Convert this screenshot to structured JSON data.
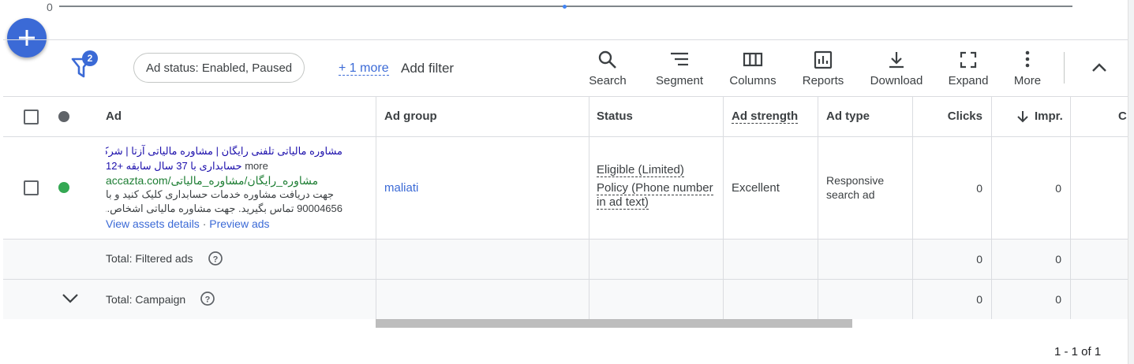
{
  "chart": {
    "zero_label": "0"
  },
  "fab": {
    "icon": "plus-icon"
  },
  "toolbar": {
    "filter_count": "2",
    "status_chip": "Ad status: Enabled, Paused",
    "more_filters": "+ 1 more",
    "add_filter": "Add filter",
    "buttons": {
      "search": "Search",
      "segment": "Segment",
      "columns": "Columns",
      "reports": "Reports",
      "download": "Download",
      "expand": "Expand",
      "more": "More"
    }
  },
  "table": {
    "headers": {
      "ad": "Ad",
      "ad_group": "Ad group",
      "status": "Status",
      "ad_strength": "Ad strength",
      "ad_type": "Ad type",
      "clicks": "Clicks",
      "impr": "Impr.",
      "ctr_partial": "C"
    },
    "row": {
      "headline_1": "مشاوره مالیاتی تلفنی رایگان | مشاوره مالیاتی آزتا | شرکت",
      "headline_2": "حسابداری با 37 سال سابقه +12",
      "headline_more": "more",
      "display_url": "accazta.com/مشاوره_رایگان/مشاوره_مالیاتی",
      "description_1": "جهت دریافت مشاوره خدمات حسابداری کلیک کنید و با",
      "description_2": "90004656 تماس بگیرید. جهت مشاوره مالیاتی اشخاص...",
      "view_assets": "View assets details",
      "separator": "·",
      "preview_ads": "Preview ads",
      "ad_group": "maliati",
      "status_1": "Eligible (Limited)",
      "status_2_a": "Policy (Phone number",
      "status_2_b": "in ad text)",
      "ad_strength": "Excellent",
      "ad_type_a": "Responsive",
      "ad_type_b": "search ad",
      "clicks": "0",
      "impr": "0",
      "status_dot_color": "#34a853"
    },
    "total_filtered": {
      "label": "Total: Filtered ads",
      "clicks": "0",
      "impr": "0"
    },
    "total_campaign": {
      "label": "Total: Campaign",
      "clicks": "0",
      "impr": "0"
    }
  },
  "pagination": "1 - 1 of 1"
}
